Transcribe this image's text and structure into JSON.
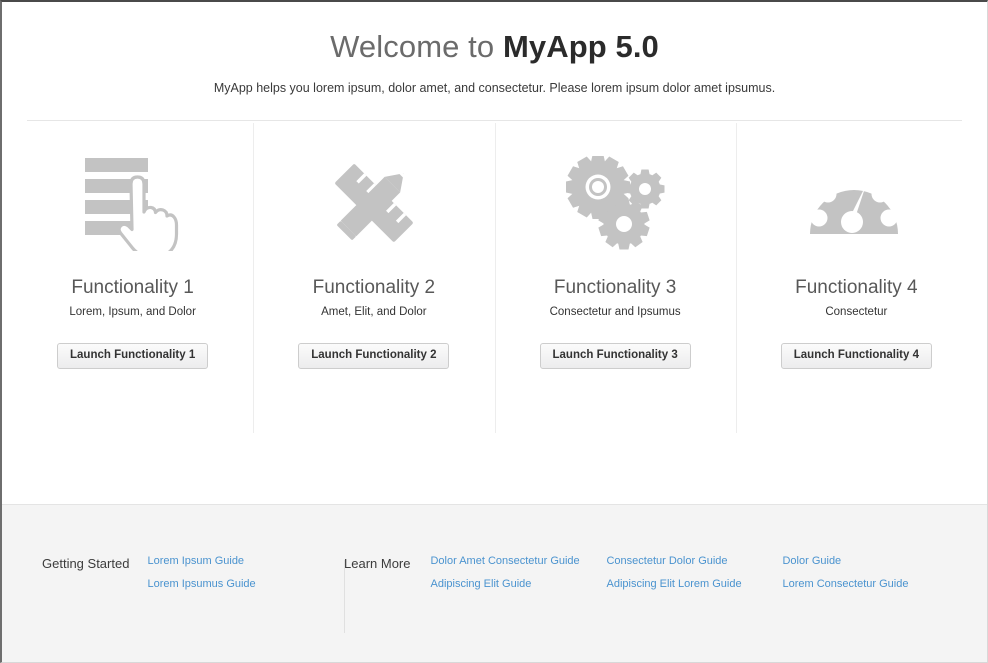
{
  "header": {
    "title_prefix": "Welcome to ",
    "title_brand": "MyApp 5.0",
    "subtitle": "MyApp helps you lorem ipsum, dolor amet, and consectetur. Please lorem ipsum dolor amet ipsumus."
  },
  "colors": {
    "page_background": "#ffffff",
    "footer_background": "#f4f4f4",
    "icon_gray": "#c3c3c3",
    "link_blue": "#4a93cf",
    "title_gray": "#585858",
    "brand_dark": "#2b2b2b",
    "divider": "#e6e6e6",
    "button_border": "#cdcdcd"
  },
  "cards": [
    {
      "icon": "list-pointer-icon",
      "title": "Functionality 1",
      "subtitle": "Lorem, Ipsum, and Dolor",
      "button_label": "Launch Functionality 1"
    },
    {
      "icon": "pencil-ruler-icon",
      "title": "Functionality 2",
      "subtitle": "Amet, Elit, and Dolor",
      "button_label": "Launch Functionality 2"
    },
    {
      "icon": "gears-icon",
      "title": "Functionality 3",
      "subtitle": "Consectetur and Ipsumus",
      "button_label": "Launch Functionality 3"
    },
    {
      "icon": "gauge-icon",
      "title": "Functionality 4",
      "subtitle": "Consectetur",
      "button_label": "Launch Functionality 4"
    }
  ],
  "footer": {
    "getting_started": {
      "heading": "Getting Started",
      "links": [
        "Lorem Ipsum Guide",
        "Lorem Ipsumus Guide"
      ]
    },
    "learn_more": {
      "heading": "Learn More",
      "column_1": [
        "Dolor Amet Consectetur Guide",
        "Adipiscing Elit Guide"
      ],
      "column_2": [
        "Consectetur Dolor Guide",
        "Adipiscing Elit Lorem Guide"
      ],
      "column_3": [
        "Dolor Guide",
        "Lorem Consectetur Guide"
      ]
    }
  }
}
